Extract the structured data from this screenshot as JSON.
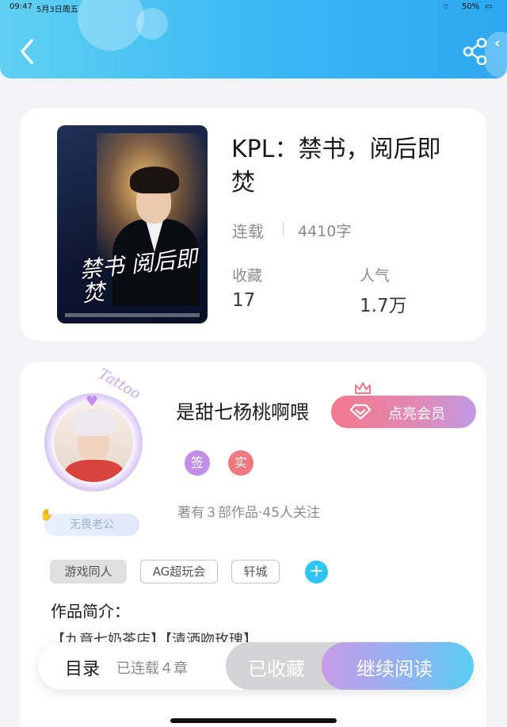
{
  "status_bar": {
    "time": "09:47",
    "date": "5月3日周五",
    "battery": "50%"
  },
  "book": {
    "title": "KPL：禁书，阅后即焚",
    "cover_text": "禁书 阅后即焚",
    "status": "连载",
    "word_count": "4410字",
    "favorites_label": "收藏",
    "favorites_value": "17",
    "popularity_label": "人气",
    "popularity_value": "1.7万"
  },
  "author": {
    "name": "是甜七杨桃啊喂",
    "vip_button": "点亮会员",
    "badge_sign": "签",
    "badge_real": "实",
    "stats": "著有３部作品·45人关注",
    "medal": "无畏老公",
    "avatar_deco": "Tattoo",
    "tags": [
      "游戏同人",
      "AG超玩会",
      "轩城"
    ],
    "add_tag": "+"
  },
  "intro": {
    "title": "作品简介：",
    "text": "【九竟七奶茶店】【清洒吻玫瑰】"
  },
  "bottom_bar": {
    "toc_label": "目录",
    "toc_progress": "已连载４章",
    "favorited_button": "已收藏",
    "continue_button": "继续阅读"
  },
  "colors": {
    "header_start": "#5fd0f2",
    "header_end": "#2ea8f0",
    "accent_blue": "#2fc4f4",
    "badge_sign": "#c18ee9",
    "badge_real": "#f0787e"
  }
}
